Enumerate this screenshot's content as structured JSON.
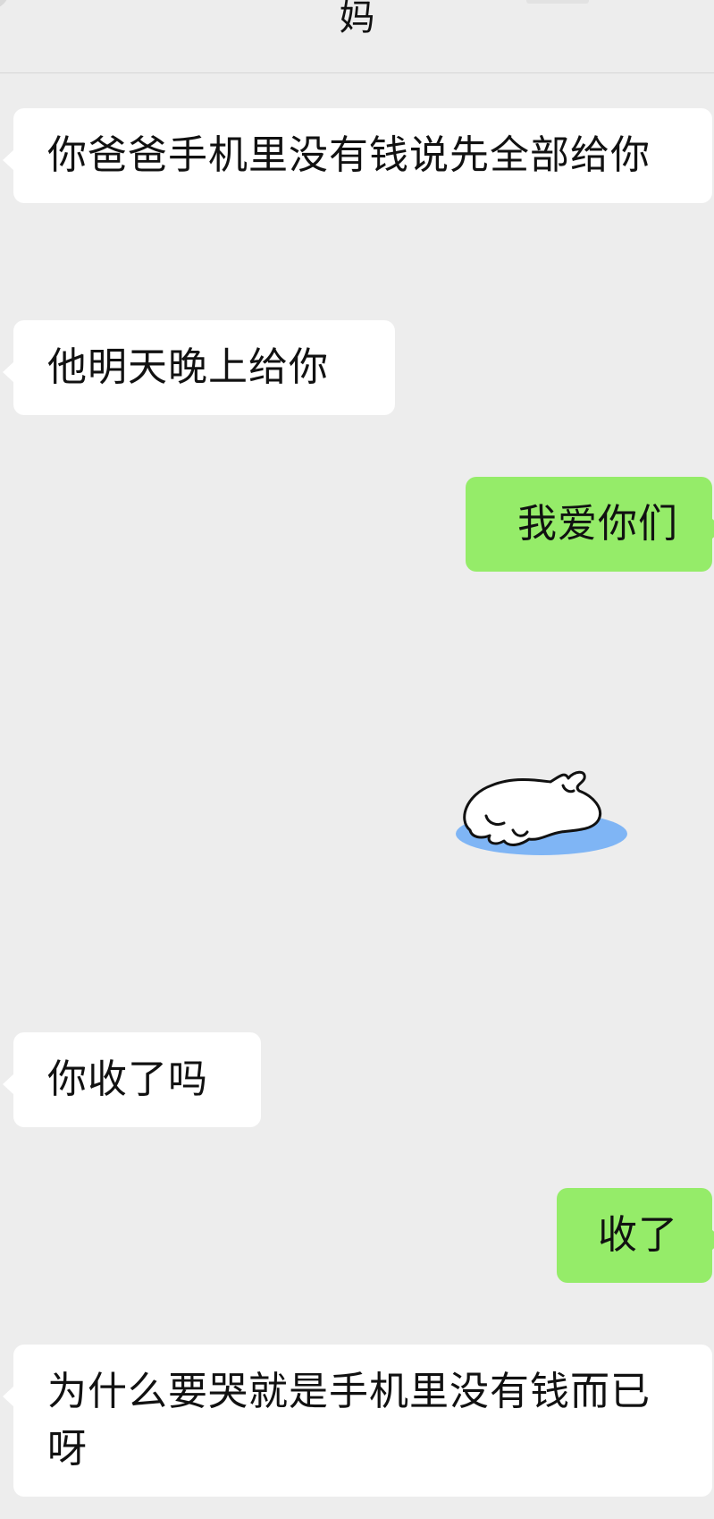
{
  "header": {
    "title": "妈"
  },
  "messages": [
    {
      "sender": "contact",
      "text": "你爸爸手机里没有钱说先全部给你"
    },
    {
      "sender": "contact",
      "text": "他明天晚上给你"
    },
    {
      "sender": "me",
      "text": "我爱你们"
    },
    {
      "sender": "me",
      "type": "sticker",
      "icon": "sleeping-white-creature-sticker"
    },
    {
      "sender": "contact",
      "text": "你收了吗"
    },
    {
      "sender": "me",
      "text": "收了"
    },
    {
      "sender": "contact",
      "text": "为什么要哭就是手机里没有钱而已呀"
    }
  ],
  "colors": {
    "background": "#ededed",
    "incoming_bubble": "#ffffff",
    "outgoing_bubble": "#95ec69",
    "sticker_shadow": "#7fb5f5"
  }
}
